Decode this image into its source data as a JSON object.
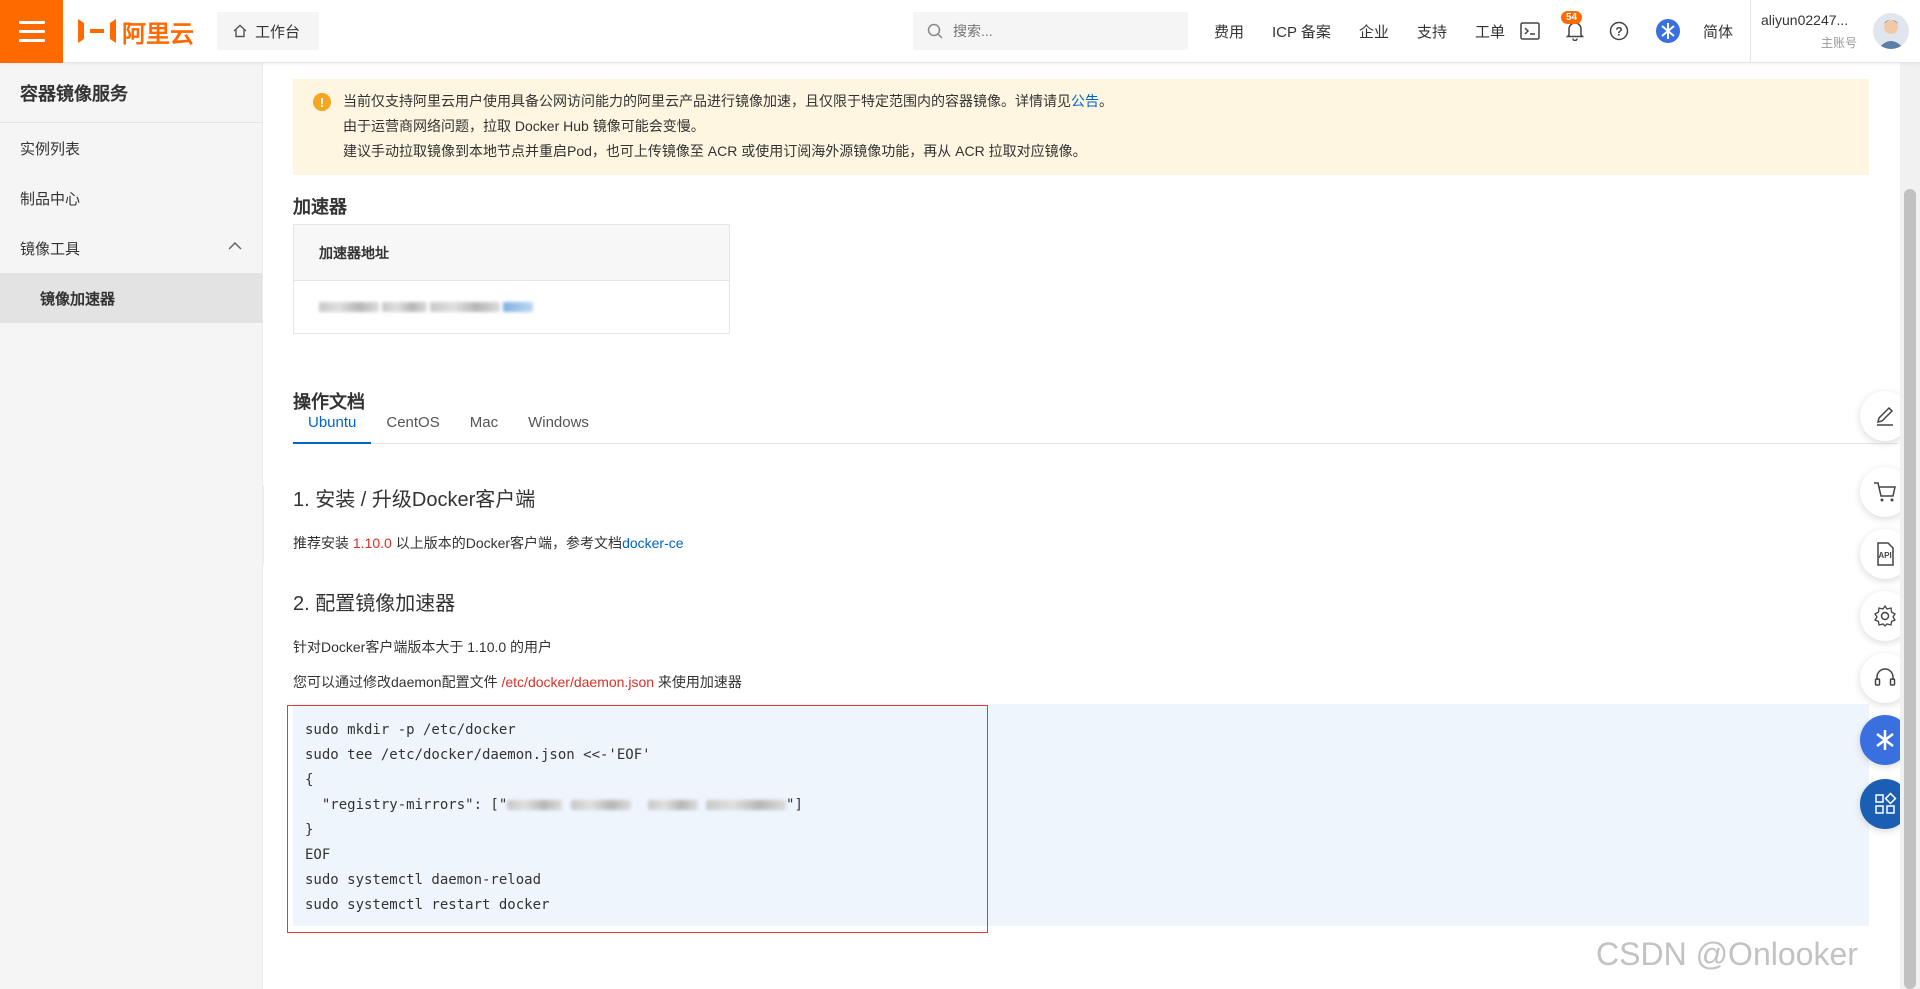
{
  "header": {
    "logo_text": "阿里云",
    "workbench_label": "工作台",
    "search_placeholder": "搜索...",
    "nav": [
      "费用",
      "ICP 备案",
      "企业",
      "支持",
      "工单"
    ],
    "notification_count": "54",
    "lang": "简体",
    "account_name": "aliyun02247...",
    "account_type": "主账号"
  },
  "sidebar": {
    "title": "容器镜像服务",
    "items": [
      {
        "label": "实例列表"
      },
      {
        "label": "制品中心"
      },
      {
        "label": "镜像工具"
      }
    ],
    "sub_item": "镜像加速器"
  },
  "notice": {
    "line1_pre": "当前仅支持阿里云用户使用具备公网访问能力的阿里云产品进行镜像加速，且仅限于特定范围内的容器镜像。详情请见",
    "line1_link": "公告",
    "line1_post": "。",
    "line2": "由于运营商网络问题，拉取 Docker Hub 镜像可能会变慢。",
    "line3": "建议手动拉取镜像到本地节点并重启Pod，也可上传镜像至 ACR 或使用订阅海外源镜像功能，再从 ACR 拉取对应镜像。"
  },
  "accelerator": {
    "section_title": "加速器",
    "column_header": "加速器地址"
  },
  "docs": {
    "section_title": "操作文档",
    "tabs": [
      "Ubuntu",
      "CentOS",
      "Mac",
      "Windows"
    ],
    "step1_title": "1. 安装 / 升级Docker客户端",
    "step1_pre": "推荐安装 ",
    "step1_version": "1.10.0",
    "step1_mid": " 以上版本的Docker客户端，参考文档",
    "step1_link": "docker-ce",
    "step2_title": "2. 配置镜像加速器",
    "step2_line1": "针对Docker客户端版本大于 1.10.0 的用户",
    "step2_line2_pre": "您可以通过修改daemon配置文件 ",
    "step2_path": "/etc/docker/daemon.json",
    "step2_line2_post": " 来使用加速器",
    "code": {
      "l1": "sudo mkdir -p /etc/docker",
      "l2": "sudo tee /etc/docker/daemon.json <<-'EOF'",
      "l3": "{",
      "l4_pre": "  \"registry-mirrors\": [\"",
      "l4_post": "\"]",
      "l5": "}",
      "l6": "EOF",
      "l7": "sudo systemctl daemon-reload",
      "l8": "sudo systemctl restart docker"
    }
  },
  "watermark": "CSDN @Onlooker",
  "colors": {
    "brand": "#ff6a00",
    "link": "#0064c8",
    "highlight_red": "#d93026",
    "notice_bg": "#fef6e1",
    "code_bg": "#eef5fd"
  }
}
